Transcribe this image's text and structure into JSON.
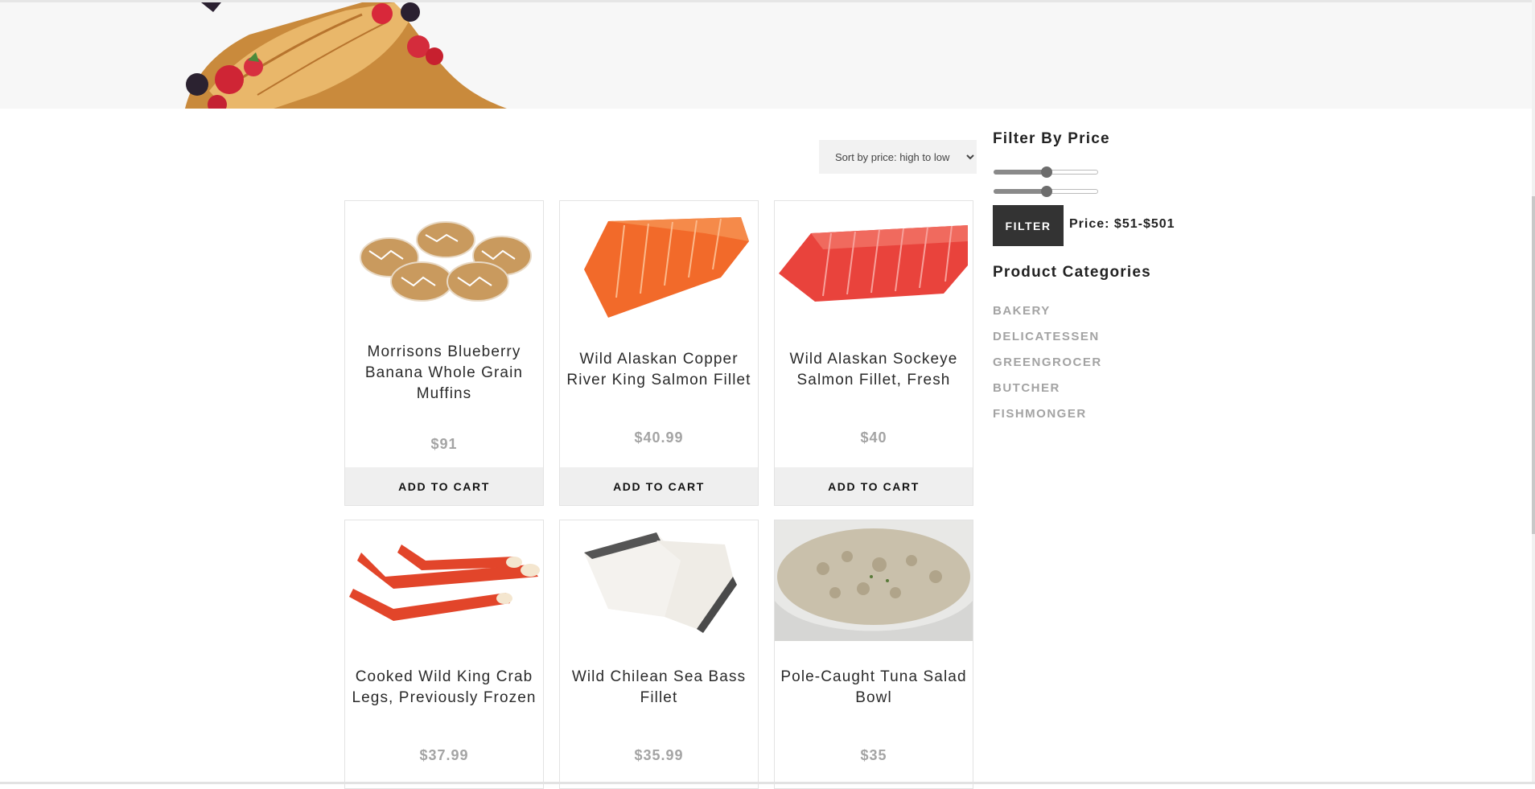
{
  "sort": {
    "selected": "Sort by price: high to low"
  },
  "products": [
    {
      "name": "Morrisons Blueberry Banana Whole Grain Muffins",
      "price": "$91",
      "cta": "ADD TO CART",
      "image": "muffins"
    },
    {
      "name": "Wild Alaskan Copper River King Salmon Fillet",
      "price": "$40.99",
      "cta": "ADD TO CART",
      "image": "salmon-fillet"
    },
    {
      "name": "Wild Alaskan Sockeye Salmon Fillet, Fresh",
      "price": "$40",
      "cta": "ADD TO CART",
      "image": "sockeye-fillet"
    },
    {
      "name": "Cooked Wild King Crab Legs, Previously Frozen",
      "price": "$37.99",
      "image": "crab-legs"
    },
    {
      "name": "Wild Chilean Sea Bass Fillet",
      "price": "$35.99",
      "image": "sea-bass"
    },
    {
      "name": "Pole-Caught Tuna Salad Bowl",
      "price": "$35",
      "image": "tuna-salad"
    }
  ],
  "sidebar": {
    "filter_title": "Filter By Price",
    "filter_button": "FILTER",
    "price_label": "Price: $51-$501",
    "slider_min_fraction": 0.51,
    "slider_max_fraction": 0.51,
    "categories_title": "Product Categories",
    "categories": [
      "BAKERY",
      "DELICATESSEN",
      "GREENGROCER",
      "BUTCHER",
      "FISHMONGER"
    ]
  },
  "colors": {
    "button_dark": "#333333",
    "muted_text": "#a4a4a4",
    "cart_bg": "#efefef"
  }
}
